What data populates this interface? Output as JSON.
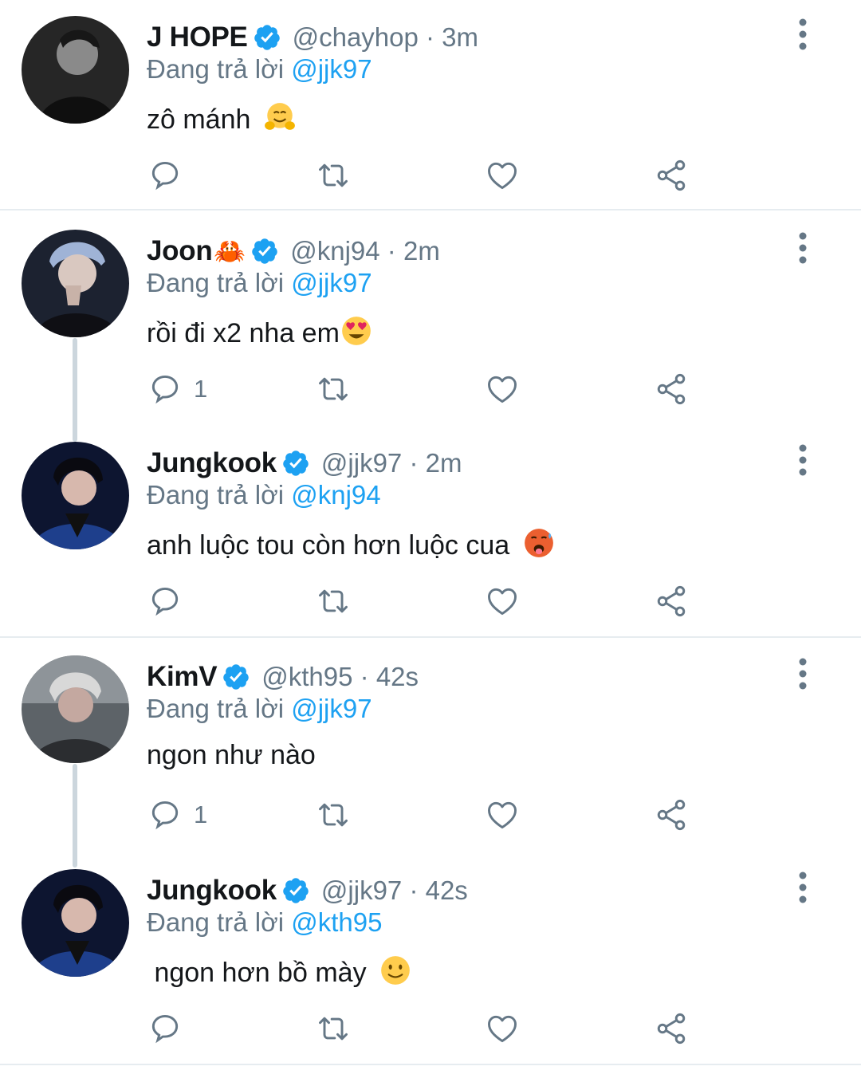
{
  "tweets": [
    {
      "name": "J HOPE",
      "name_emoji": "",
      "handle": "@chayhop · 3m",
      "reply_prefix": "Đang trả lời",
      "reply_to": "@jjk97",
      "text": "zô mánh",
      "text_emoji": "hugging-face",
      "reply_count": "",
      "avatar_tone": "grayscale"
    },
    {
      "name": "Joon",
      "name_emoji": "🦀",
      "handle": "@knj94 · 2m",
      "reply_prefix": "Đang trả lời",
      "reply_to": "@jjk97",
      "text": "rồi đi x2 nha em",
      "text_emoji": "heart-eyes",
      "reply_count": "1",
      "avatar_tone": "blue-silver"
    },
    {
      "name": "Jungkook",
      "name_emoji": "",
      "handle": "@jjk97 · 2m",
      "reply_prefix": "Đang trả lời",
      "reply_to": "@knj94",
      "text": "anh luộc tou còn hơn luộc cua",
      "text_emoji": "hot-face",
      "reply_count": "",
      "avatar_tone": "navy"
    },
    {
      "name": "KimV",
      "name_emoji": "",
      "handle": "@kth95 · 42s",
      "reply_prefix": "Đang trả lời",
      "reply_to": "@jjk97",
      "text": "ngon như nào",
      "text_emoji": "",
      "reply_count": "1",
      "avatar_tone": "muted-gray"
    },
    {
      "name": "Jungkook",
      "name_emoji": "",
      "handle": "@jjk97 · 42s",
      "reply_prefix": "Đang trả lời",
      "reply_to": "@kth95",
      "text": " ngon hơn bồ mày",
      "text_emoji": "slight-smile",
      "reply_count": "",
      "avatar_tone": "navy"
    }
  ],
  "icons": {
    "reply": "reply-icon",
    "retweet": "retweet-icon",
    "like": "heart-icon",
    "share": "share-icon",
    "more": "more-vertical-icon",
    "verified": "verified-badge-icon"
  },
  "colors": {
    "accent": "#1da1f2",
    "secondary_text": "#657786",
    "divider": "#e6ecf0",
    "thread_line": "#ccd6dd"
  }
}
